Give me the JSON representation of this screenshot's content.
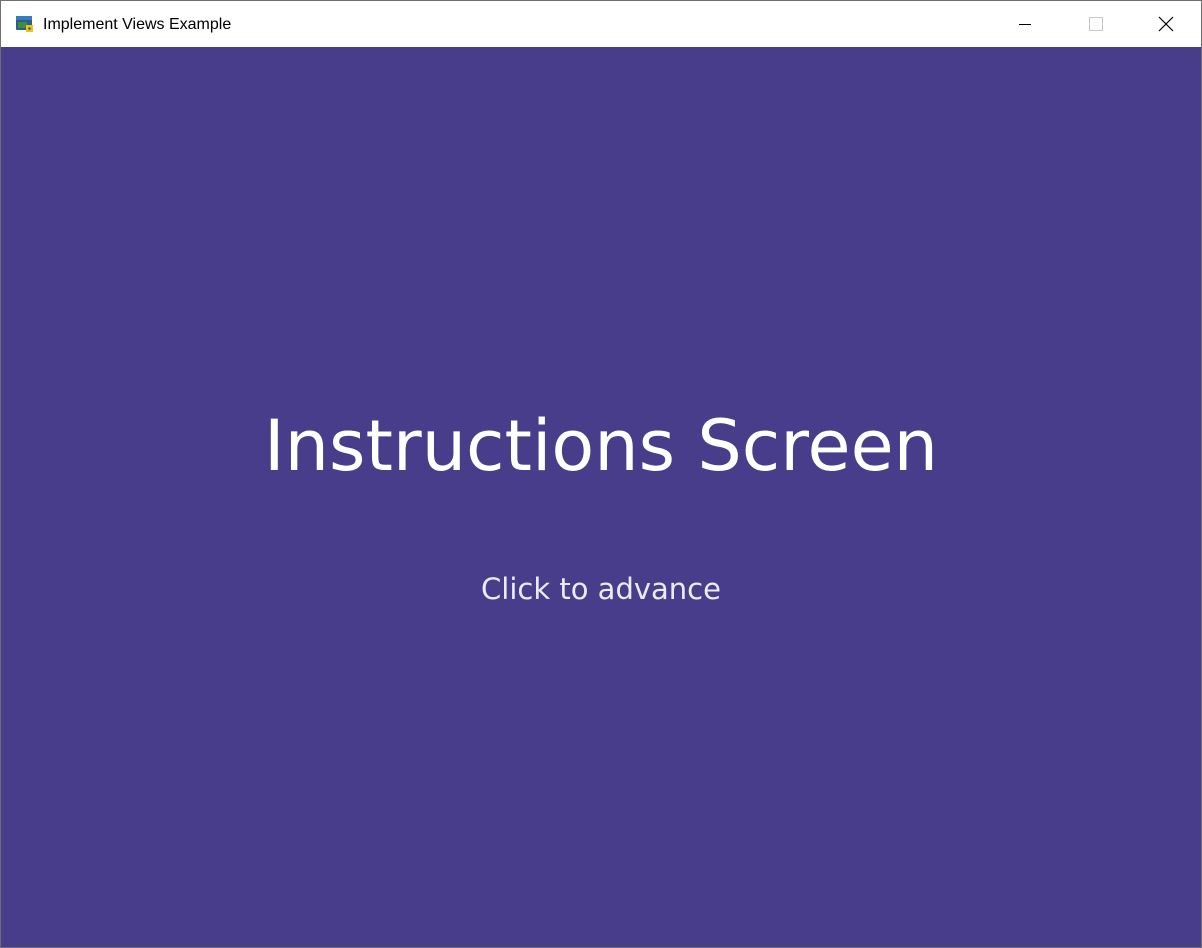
{
  "window": {
    "title": "Implement Views Example",
    "icon": "python-app-icon"
  },
  "caption_buttons": {
    "minimize": "minimize-icon",
    "maximize": "maximize-icon",
    "close": "close-icon"
  },
  "view": {
    "background_color": "#483d8b",
    "heading": "Instructions Screen",
    "prompt": "Click to advance"
  }
}
